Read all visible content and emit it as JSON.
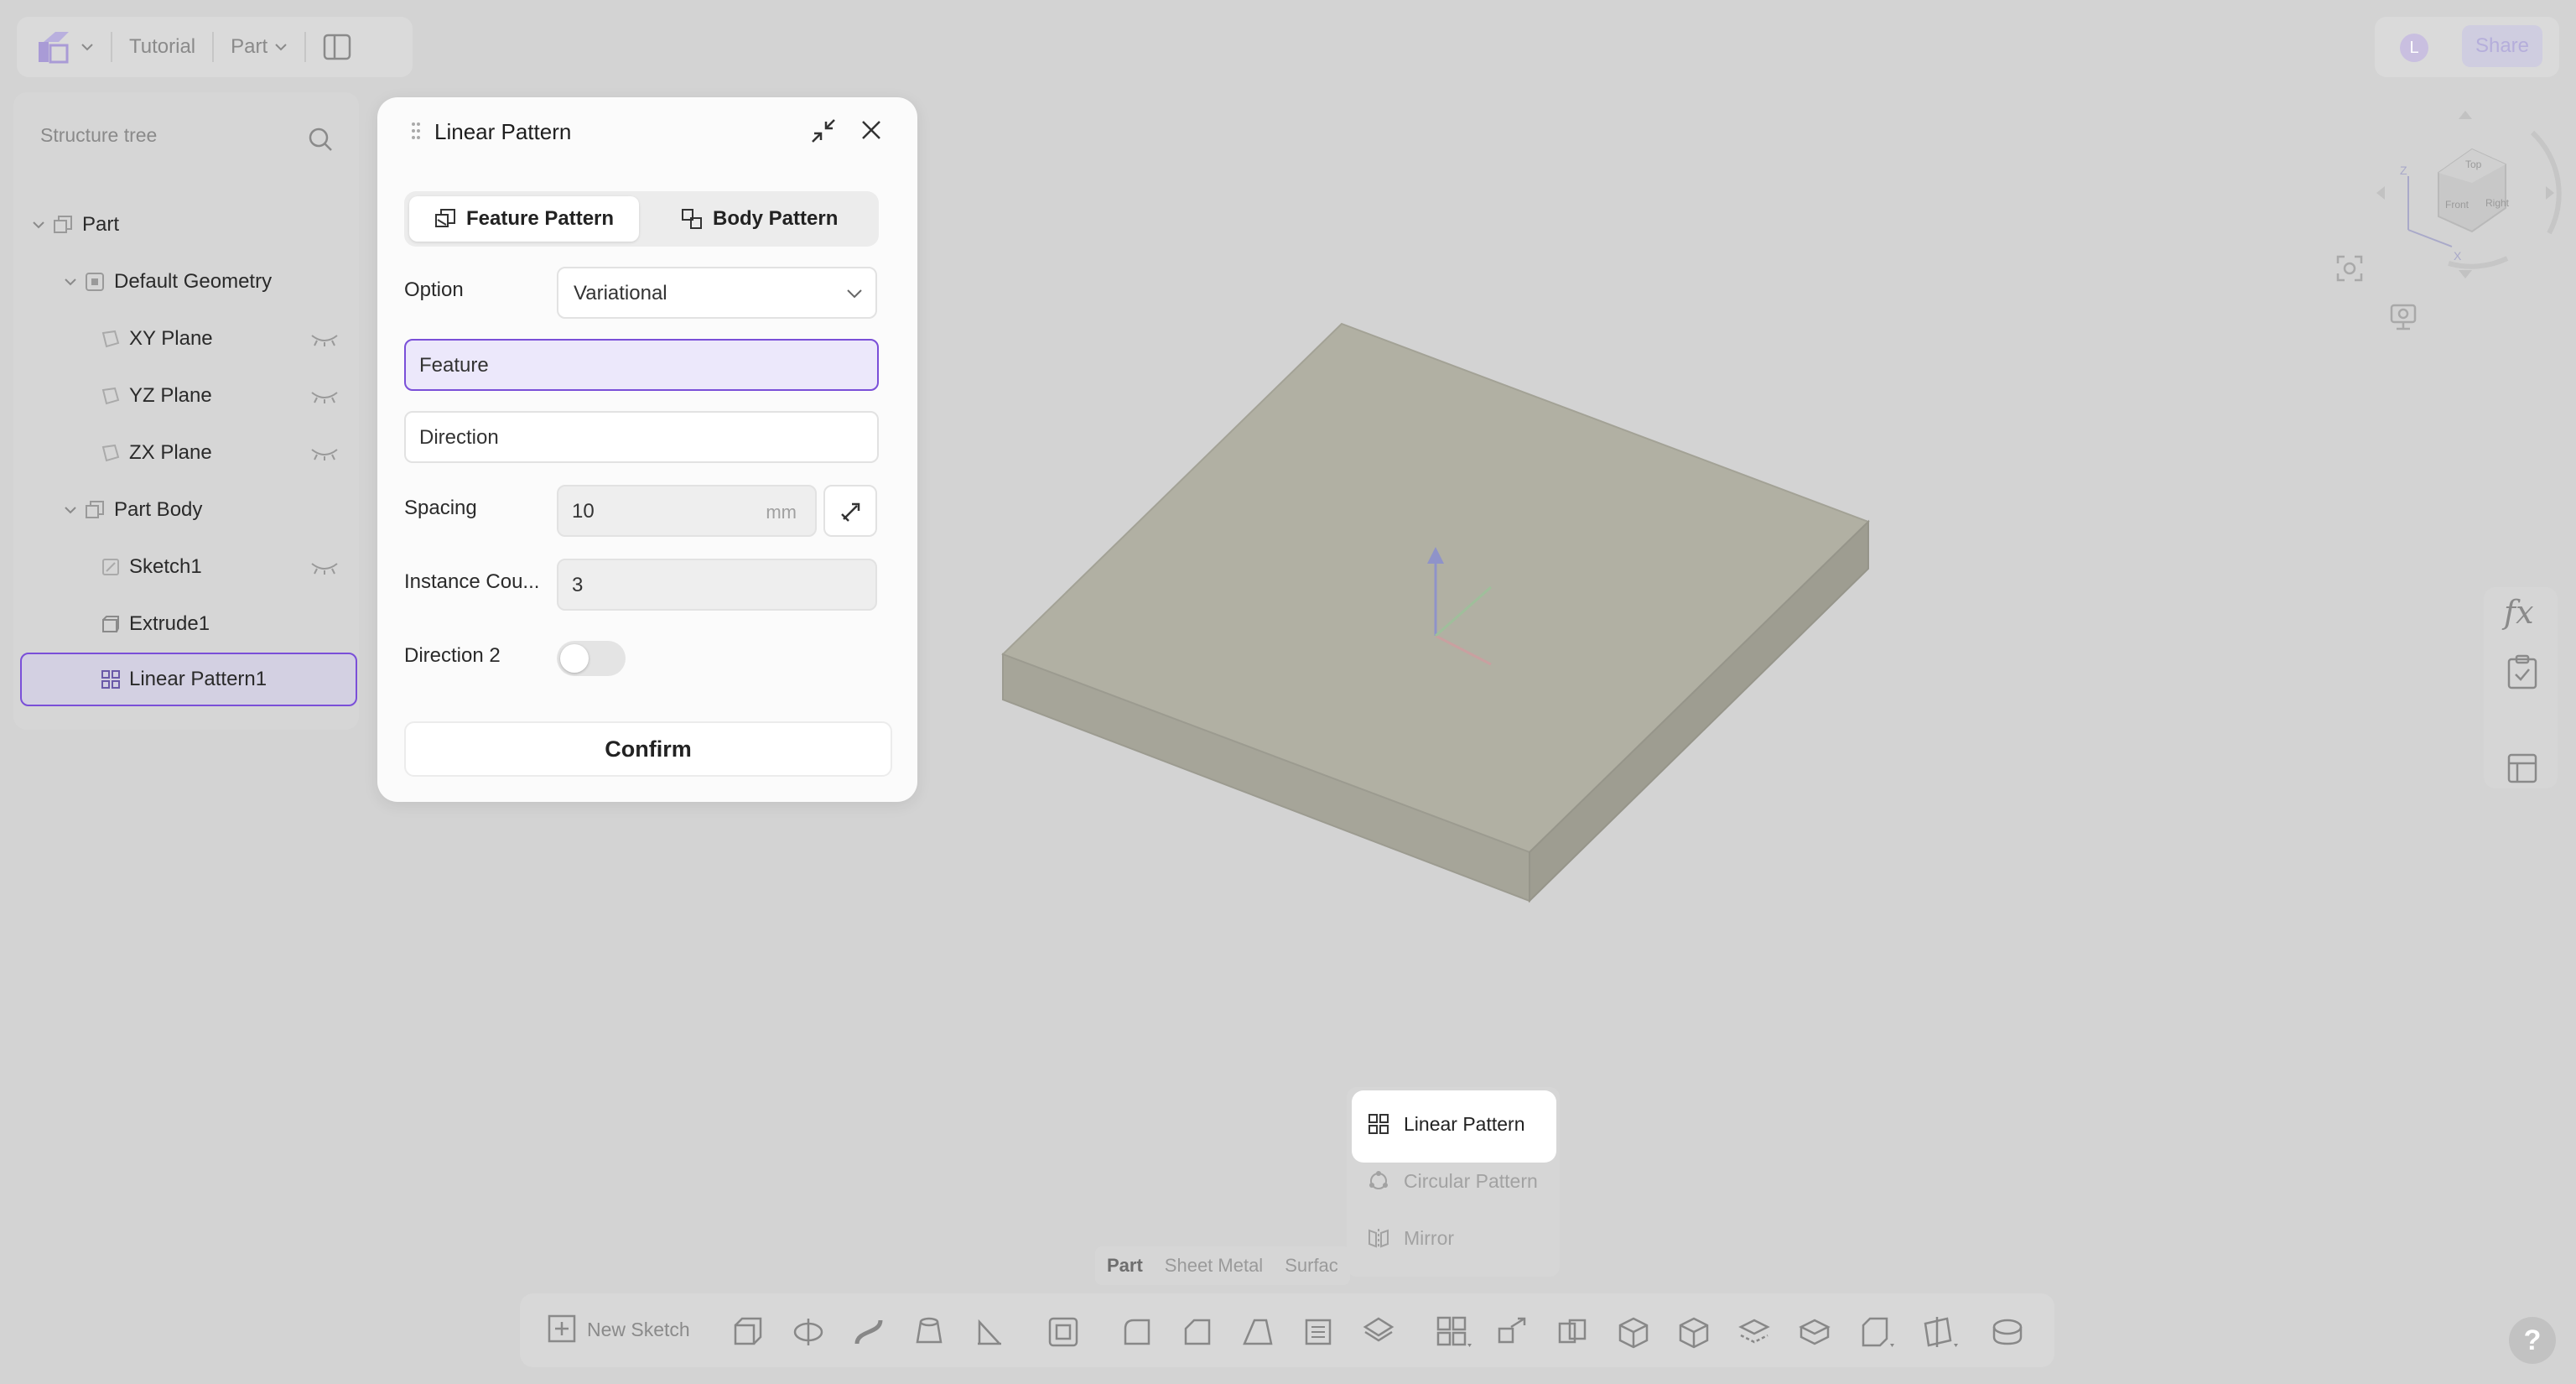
{
  "topbar": {
    "breadcrumb_1": "Tutorial",
    "breadcrumb_2": "Part"
  },
  "topright": {
    "avatar_initial": "L",
    "share_label": "Share"
  },
  "tree": {
    "header": "Structure tree",
    "items": [
      {
        "label": "Part"
      },
      {
        "label": "Default Geometry"
      },
      {
        "label": "XY Plane"
      },
      {
        "label": "YZ Plane"
      },
      {
        "label": "ZX Plane"
      },
      {
        "label": "Part Body"
      },
      {
        "label": "Sketch1"
      },
      {
        "label": "Extrude1"
      },
      {
        "label": "Linear Pattern1"
      }
    ]
  },
  "dialog": {
    "title": "Linear Pattern",
    "tab_feature": "Feature Pattern",
    "tab_body": "Body Pattern",
    "option_label": "Option",
    "option_value": "Variational",
    "feature_placeholder": "Feature",
    "direction_placeholder": "Direction",
    "spacing_label": "Spacing",
    "spacing_value": "10",
    "spacing_unit": "mm",
    "instance_label": "Instance Cou...",
    "instance_value": "3",
    "direction2_label": "Direction 2",
    "direction2_on": false,
    "confirm_label": "Confirm"
  },
  "menu": {
    "items": [
      "Linear Pattern",
      "Circular Pattern",
      "Mirror"
    ]
  },
  "bottom_tabs": [
    "Part",
    "Sheet Metal",
    "Surfac"
  ],
  "toolbar": {
    "new_sketch": "New Sketch"
  },
  "right_panel": {
    "fx_label": "fx"
  },
  "help": {
    "label": "?"
  },
  "colors": {
    "accent": "#7a4fd8",
    "viewport_bg": "#d3d3d3",
    "dialog_bg": "#fbfbfb",
    "model_top": "#b1b0a3"
  }
}
